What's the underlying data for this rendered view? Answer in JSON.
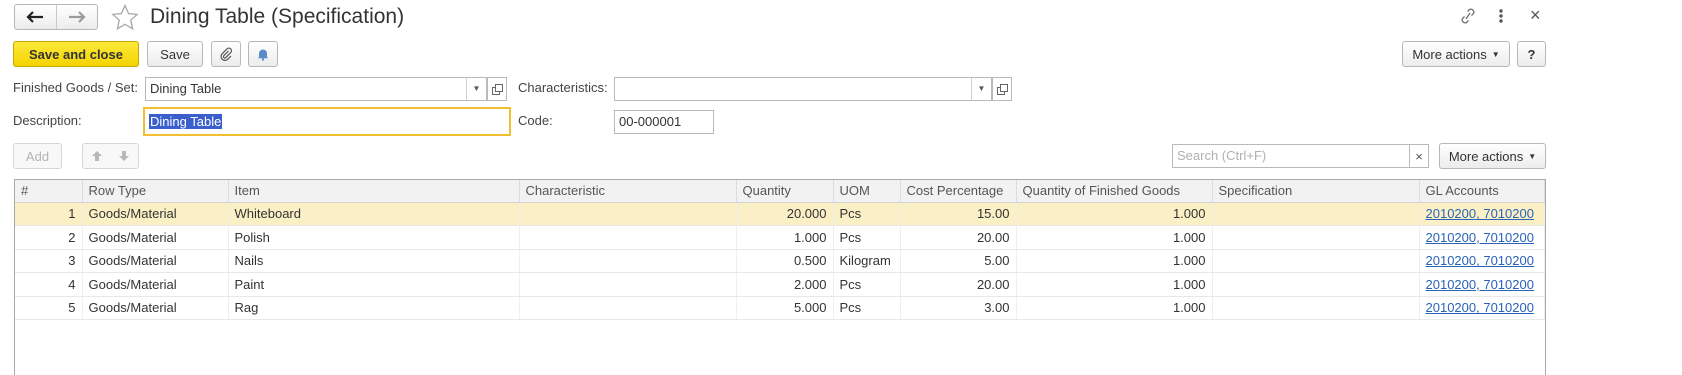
{
  "window": {
    "title": "Dining Table (Specification)",
    "close_icon": "×"
  },
  "toolbar": {
    "save_and_close": "Save and close",
    "save": "Save",
    "more_actions": "More actions",
    "help": "?"
  },
  "form": {
    "finished_goods_label": "Finished Goods / Set:",
    "finished_goods_value": "Dining Table",
    "characteristics_label": "Characteristics:",
    "characteristics_value": "",
    "description_label": "Description:",
    "description_value": "Dining Table",
    "code_label": "Code:",
    "code_value": "00-000001"
  },
  "table_toolbar": {
    "add": "Add",
    "search_placeholder": "Search (Ctrl+F)",
    "clear": "×",
    "more_actions": "More actions"
  },
  "table": {
    "columns": [
      "#",
      "Row Type",
      "Item",
      "Characteristic",
      "Quantity",
      "UOM",
      "Cost Percentage",
      "Quantity of Finished Goods",
      "Specification",
      "GL Accounts"
    ],
    "rows": [
      {
        "n": "1",
        "row_type": "Goods/Material",
        "item": "Whiteboard",
        "characteristic": "",
        "quantity": "20.000",
        "uom": "Pcs",
        "cost_pct": "15.00",
        "qty_fg": "1.000",
        "specification": "",
        "gl": "2010200, 7010200"
      },
      {
        "n": "2",
        "row_type": "Goods/Material",
        "item": "Polish",
        "characteristic": "",
        "quantity": "1.000",
        "uom": "Pcs",
        "cost_pct": "20.00",
        "qty_fg": "1.000",
        "specification": "",
        "gl": "2010200, 7010200"
      },
      {
        "n": "3",
        "row_type": "Goods/Material",
        "item": "Nails",
        "characteristic": "",
        "quantity": "0.500",
        "uom": "Kilogram",
        "cost_pct": "5.00",
        "qty_fg": "1.000",
        "specification": "",
        "gl": "2010200, 7010200"
      },
      {
        "n": "4",
        "row_type": "Goods/Material",
        "item": "Paint",
        "characteristic": "",
        "quantity": "2.000",
        "uom": "Pcs",
        "cost_pct": "20.00",
        "qty_fg": "1.000",
        "specification": "",
        "gl": "2010200, 7010200"
      },
      {
        "n": "5",
        "row_type": "Goods/Material",
        "item": "Rag",
        "characteristic": "",
        "quantity": "5.000",
        "uom": "Pcs",
        "cost_pct": "3.00",
        "qty_fg": "1.000",
        "specification": "",
        "gl": "2010200, 7010200"
      }
    ]
  },
  "colors": {
    "accent_yellow": "#f4d300",
    "selected_row": "#fbf0c5",
    "focus_border": "#f0c030",
    "selection_highlight": "#3a5fcd",
    "link": "#2a63b8"
  },
  "icons": {
    "back": "arrow-left-icon",
    "forward": "arrow-right-icon",
    "favorite": "star-icon",
    "link": "link-icon",
    "menu": "vertical-dots-icon",
    "close": "close-icon",
    "attach": "paperclip-icon",
    "notify": "bell-icon",
    "up": "arrow-up-icon",
    "down": "arrow-down-icon"
  }
}
